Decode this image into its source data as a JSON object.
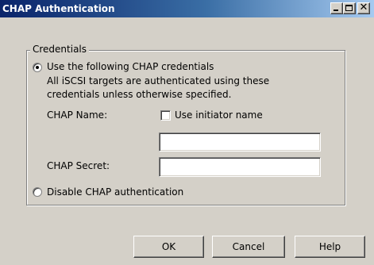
{
  "window": {
    "title": "CHAP Authentication",
    "controls": {
      "minimize_icon": "minimize-icon",
      "maximize_icon": "maximize-icon",
      "close_icon": "close-icon",
      "close_glyph": "✕"
    }
  },
  "credentials": {
    "group_label": "Credentials",
    "option_use": {
      "label": "Use the following CHAP credentials",
      "selected": true
    },
    "description_line1": "All iSCSI targets are authenticated using these",
    "description_line2": "credentials unless otherwise specified.",
    "chap_name_label": "CHAP Name:",
    "use_initiator_name": {
      "label": "Use initiator name",
      "checked": false
    },
    "chap_name_value": "",
    "chap_secret_label": "CHAP Secret:",
    "chap_secret_value": "",
    "option_disable": {
      "label": "Disable CHAP authentication",
      "selected": false
    }
  },
  "buttons": {
    "ok": "OK",
    "cancel": "Cancel",
    "help": "Help"
  },
  "colors": {
    "titlebar_start": "#0a246a",
    "titlebar_end": "#a6caf0",
    "face": "#d4d0c8"
  }
}
